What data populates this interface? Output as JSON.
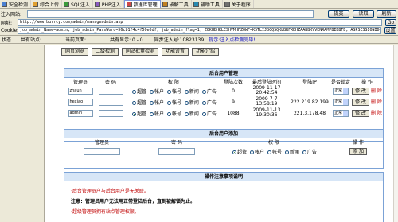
{
  "tabs": [
    {
      "label": "安全检测",
      "active": false
    },
    {
      "label": "综合上传",
      "active": false
    },
    {
      "label": "SQL注入",
      "active": false
    },
    {
      "label": "PHP注入",
      "active": false
    },
    {
      "label": "数据库管理",
      "active": true
    },
    {
      "label": "破解工具",
      "active": false
    },
    {
      "label": "辅助工具",
      "active": false
    },
    {
      "label": "关于程序",
      "active": false
    }
  ],
  "injection": {
    "label": "注入网站:",
    "url_value": "",
    "submit_label": "提交",
    "read_label": "读取",
    "refresh_label": "刷新"
  },
  "address": {
    "label": "网址:",
    "value": "http://www.burrcy.com/admin/manageadmin.asp",
    "go_label": "Go"
  },
  "cookies": {
    "label": "Cookies:",
    "value": "job_admin_Name=admin; job_admin_PassWord=56cb1f4c4f50e6df; job_admin_flag=1; ZOKHBHKLESHVMHFZOWF=KSTLIJBCQSQKLBRFXBHZAABBKYVENRAMPBIBBFD; ASPSESSIONIDQCTCCRTBR=LPMKCHEBRKKEFABBBDDNPLNPHJ",
    "set_label": "设置"
  },
  "status": {
    "label": "状态",
    "site_count": "共有站点:",
    "current_page": "当前页面:",
    "info": "共有显示: 0 - 0",
    "sync": "同步注入号:10823139",
    "hint": "提示:注入点检测完毕!"
  },
  "nav_buttons": [
    "网页浏览",
    "二级检测",
    "同站批量检测",
    "功能设置",
    "功能介绍"
  ],
  "admin_panel": {
    "title": "后台用户管理",
    "columns": [
      "管理员",
      "密 码",
      "权 限",
      "登陆次数",
      "最后登陆时间",
      "登陆IP",
      "是否锁定",
      "操 作"
    ],
    "rows": [
      {
        "user": "zhaun",
        "password": "",
        "role": "超管",
        "logins": "0",
        "last_time": "2009-11-17 20:42:54",
        "ip": "",
        "lock": "正常",
        "action": "修 改",
        "delete": "删 除"
      },
      {
        "user": "hexiao",
        "password": "",
        "role": "超管",
        "logins": "9",
        "last_time": "2009-7-7 13:58:19",
        "ip": "222.219.82.199",
        "lock": "正常",
        "action": "修 改",
        "delete": "删 除"
      },
      {
        "user": "admin",
        "password": "",
        "role": "超管",
        "logins": "1088",
        "last_time": "2009-11-13 19:30:36",
        "ip": "221.3.178.48",
        "lock": "正常",
        "action": "修 改",
        "delete": "删 除"
      }
    ],
    "role_options": [
      "超管",
      "帐户",
      "帐号",
      "新闻",
      "广告"
    ]
  },
  "add_panel": {
    "title": "后台用户添加",
    "columns": [
      "管理员",
      "密 码",
      "权 限",
      "操 作"
    ],
    "role_options": [
      "超管",
      "帐户",
      "帐号",
      "新闻",
      "广告"
    ],
    "add_label": "添 加"
  },
  "notice_panel": {
    "title": "操作注意事项说明",
    "lines": [
      {
        "text": "·后台管理员户与后台用户是无关联。",
        "style": "red"
      },
      {
        "text": "注意：管理员用户无法用正常登陆后台，直到被解锁为止。",
        "style": "bold"
      },
      {
        "text": "·超级管理员拥有站点管理权限。",
        "style": "red"
      }
    ]
  }
}
